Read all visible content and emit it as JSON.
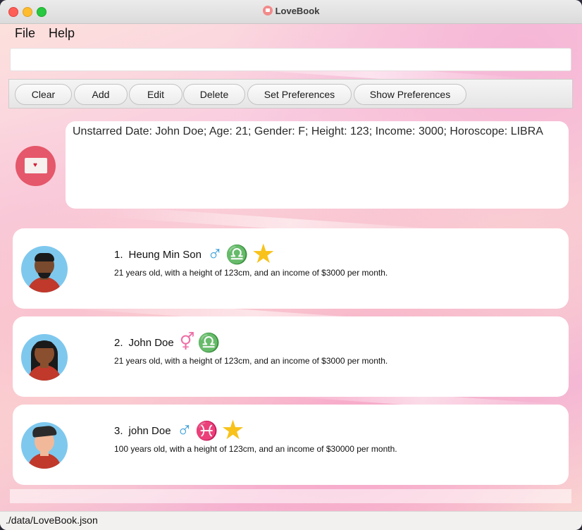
{
  "window": {
    "title": "LoveBook"
  },
  "menu": {
    "file": "File",
    "help": "Help"
  },
  "command": {
    "value": "",
    "placeholder": ""
  },
  "toolbar": {
    "clear": "Clear",
    "add": "Add",
    "edit": "Edit",
    "delete": "Delete",
    "set_preferences": "Set Preferences",
    "show_preferences": "Show Preferences"
  },
  "result": {
    "text": "Unstarred Date: John Doe; Age: 21; Gender: F; Height: 123; Income: 3000; Horoscope: LIBRA"
  },
  "dates": [
    {
      "index": "1.",
      "name": "Heung Min Son",
      "gender_icon": "male-icon",
      "gender_glyph": "♂",
      "horoscope_icon": "libra-icon",
      "horoscope_glyph": "♎",
      "starred": true,
      "star_glyph": "★",
      "description": "21 years old, with a height of 123cm, and an income of $3000 per month."
    },
    {
      "index": "2.",
      "name": "John Doe",
      "gender_icon": "female-icon",
      "gender_glyph": "⚥",
      "horoscope_icon": "libra-icon",
      "horoscope_glyph": "♎",
      "starred": false,
      "description": "21 years old, with a height of 123cm, and an income of $3000 per month."
    },
    {
      "index": "3.",
      "name": "john Doe",
      "gender_icon": "male-icon",
      "gender_glyph": "♂",
      "horoscope_icon": "pisces-icon",
      "horoscope_glyph": "♓",
      "starred": true,
      "star_glyph": "★",
      "description": "100 years old, with a height of 123cm, and an income of $30000 per month."
    }
  ],
  "status": {
    "path": "./data/LoveBook.json"
  },
  "colors": {
    "accent": "#e5576a",
    "male": "#3aa0d8",
    "star": "#f8c21a",
    "female": "#ee6fa6"
  }
}
